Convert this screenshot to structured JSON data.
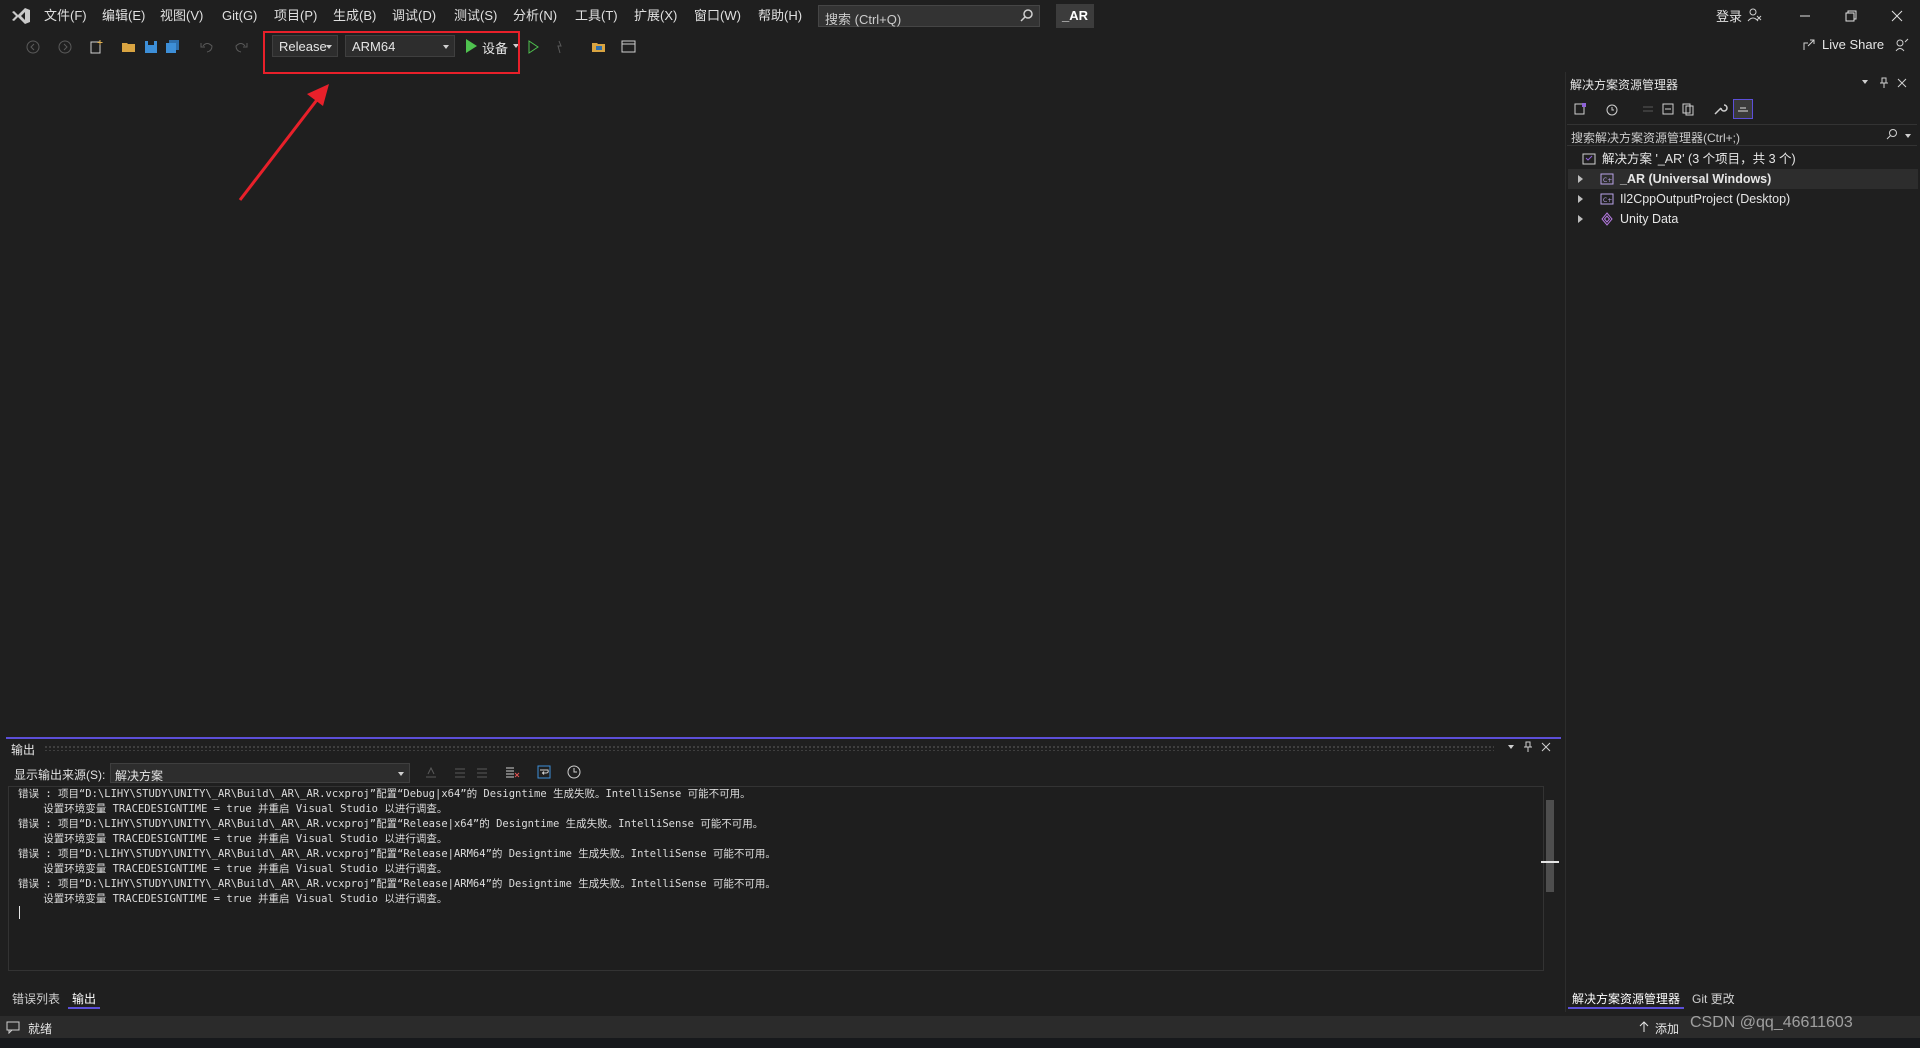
{
  "menubar": {
    "items": [
      "文件(F)",
      "编辑(E)",
      "视图(V)",
      "Git(G)",
      "项目(P)",
      "生成(B)",
      "调试(D)",
      "测试(S)",
      "分析(N)",
      "工具(T)",
      "扩展(X)",
      "窗口(W)",
      "帮助(H)"
    ],
    "search_placeholder": "搜索 (Ctrl+Q)",
    "solution_name": "_AR",
    "login_label": "登录"
  },
  "toolbar": {
    "configuration": "Release",
    "platform": "ARM64",
    "run_target": "设备",
    "live_share": "Live Share"
  },
  "solution_explorer": {
    "title": "解决方案资源管理器",
    "search_placeholder": "搜索解决方案资源管理器(Ctrl+;)",
    "root": "解决方案 '_AR' (3 个项目，共 3 个)",
    "items": [
      {
        "label": "_AR (Universal Windows)",
        "bold": true
      },
      {
        "label": "Il2CppOutputProject (Desktop)",
        "bold": false
      },
      {
        "label": "Unity Data",
        "bold": false
      }
    ]
  },
  "output": {
    "title": "输出",
    "source_label": "显示输出来源(S):",
    "source_value": "解决方案",
    "lines": [
      "错误 : 项目“D:\\LIHY\\STUDY\\UNITY\\_AR\\Build\\_AR\\_AR.vcxproj”配置“Debug|x64”的 Designtime 生成失败。IntelliSense 可能不可用。",
      "    设置环境变量 TRACEDESIGNTIME = true 并重启 Visual Studio 以进行调查。",
      "错误 : 项目“D:\\LIHY\\STUDY\\UNITY\\_AR\\Build\\_AR\\_AR.vcxproj”配置“Release|x64”的 Designtime 生成失败。IntelliSense 可能不可用。",
      "    设置环境变量 TRACEDESIGNTIME = true 并重启 Visual Studio 以进行调查。",
      "错误 : 项目“D:\\LIHY\\STUDY\\UNITY\\_AR\\Build\\_AR\\_AR.vcxproj”配置“Release|ARM64”的 Designtime 生成失败。IntelliSense 可能不可用。",
      "    设置环境变量 TRACEDESIGNTIME = true 并重启 Visual Studio 以进行调查。",
      "错误 : 项目“D:\\LIHY\\STUDY\\UNITY\\_AR\\Build\\_AR\\_AR.vcxproj”配置“Release|ARM64”的 Designtime 生成失败。IntelliSense 可能不可用。",
      "    设置环境变量 TRACEDESIGNTIME = true 并重启 Visual Studio 以进行调查。"
    ]
  },
  "bottom_tabs": {
    "left": [
      "错误列表",
      "输出"
    ],
    "right": [
      "解决方案资源管理器",
      "Git 更改"
    ]
  },
  "statusbar": {
    "ready": "就绪",
    "add": "添加",
    "watermark": "CSDN @qq_46611603"
  },
  "colors": {
    "background": "#1f1f1f",
    "accent": "#5c4fd8",
    "highlight_box": "#e8202a",
    "arrow": "#e8202a"
  }
}
